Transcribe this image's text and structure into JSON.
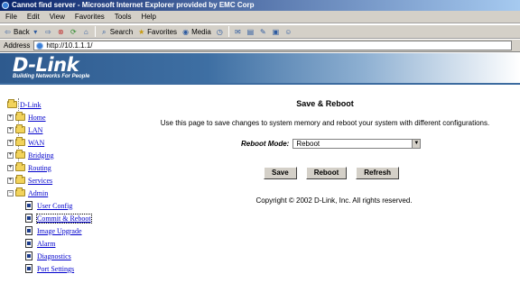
{
  "window": {
    "title": "Cannot find server - Microsoft Internet Explorer provided by EMC Corp"
  },
  "menu": [
    "File",
    "Edit",
    "View",
    "Favorites",
    "Tools",
    "Help"
  ],
  "toolbar": {
    "back": "Back",
    "search": "Search",
    "favorites": "Favorites",
    "media": "Media"
  },
  "address": {
    "label": "Address",
    "url": "http://10.1.1.1/"
  },
  "banner": {
    "logo": "D-Link",
    "tagline": "Building Networks For People"
  },
  "nav": {
    "root": "D-Link",
    "items": [
      "Home",
      "LAN",
      "WAN",
      "Bridging",
      "Routing",
      "Services",
      "Admin"
    ],
    "admin_children": [
      "User Config",
      "Commit & Reboot",
      "Image Upgrade",
      "Alarm",
      "Diagnostics",
      "Port Settings"
    ]
  },
  "main": {
    "title": "Save & Reboot",
    "description": "Use this page to save changes to system memory and reboot your system with different configurations.",
    "mode_label": "Reboot Mode:",
    "mode_value": "Reboot",
    "buttons": {
      "save": "Save",
      "reboot": "Reboot",
      "refresh": "Refresh"
    },
    "copyright": "Copyright © 2002 D-Link, Inc. All rights reserved."
  }
}
